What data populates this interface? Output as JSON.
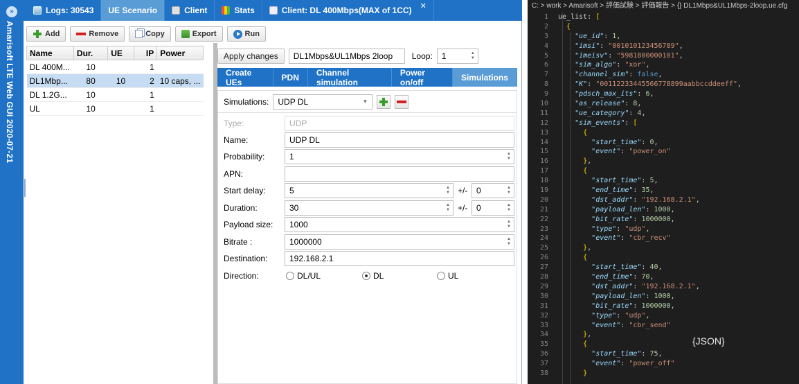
{
  "sidebar": {
    "title": "Amarisoft LTE Web GUI 2020-07-21"
  },
  "tabs": [
    {
      "label": "Logs: 30543"
    },
    {
      "label": "UE Scenario"
    },
    {
      "label": "Client"
    },
    {
      "label": "Stats"
    },
    {
      "label": "Client: DL 400Mbps(MAX of 1CC)"
    }
  ],
  "toolbar": {
    "add": "Add",
    "remove": "Remove",
    "copy": "Copy",
    "export": "Export",
    "run": "Run"
  },
  "ue_table": {
    "headers": [
      "Name",
      "Dur.",
      "UE",
      "IP",
      "Power"
    ],
    "rows": [
      [
        "DL 400M...",
        "10",
        "",
        "1",
        ""
      ],
      [
        "DL1Mbp...",
        "80",
        "10",
        "2",
        "10 caps, ..."
      ],
      [
        "DL 1.2G...",
        "10",
        "",
        "1",
        ""
      ],
      [
        "UL",
        "10",
        "",
        "1",
        ""
      ]
    ]
  },
  "scenario": {
    "apply": "Apply changes",
    "name": "DL1Mbps&UL1Mbps 2loop",
    "loop_label": "Loop:",
    "loop": "1"
  },
  "subtabs": [
    "Create UEs",
    "PDN",
    "Channel simulation",
    "Power on/off",
    "Simulations"
  ],
  "simulations": {
    "label": "Simulations:",
    "selected": "UDP DL"
  },
  "form": {
    "type": {
      "label": "Type:",
      "value": "UDP"
    },
    "name": {
      "label": "Name:",
      "value": "UDP DL"
    },
    "probability": {
      "label": "Probability:",
      "value": "1"
    },
    "apn": {
      "label": "APN:",
      "value": ""
    },
    "start_delay": {
      "label": "Start delay:",
      "value": "5",
      "pm": "+/-",
      "var": "0"
    },
    "duration": {
      "label": "Duration:",
      "value": "30",
      "pm": "+/-",
      "var": "0"
    },
    "payload": {
      "label": "Payload size:",
      "value": "1000"
    },
    "bitrate": {
      "label": "Bitrate :",
      "value": "1000000"
    },
    "destination": {
      "label": "Destination:",
      "value": "192.168.2.1"
    },
    "direction": {
      "label": "Direction:",
      "options": [
        "DL/UL",
        "DL",
        "UL"
      ],
      "selected": "DL"
    }
  },
  "editor": {
    "breadcrumb": "C: > work > Amarisoft > 評価試験 > 評価報告 > {} DL1Mbps&UL1Mbps-2loop.ue.cfg",
    "lines": [
      "ue_list: [",
      "  {",
      "    \"ue_id\": 1,",
      "    \"imsi\": \"001010123456789\",",
      "    \"imeisv\": \"5981800000101\",",
      "    \"sim_algo\": \"xor\",",
      "    \"channel_sim\": false,",
      "    \"K\": \"00112233445566778899aabbccddeeff\",",
      "    \"pdsch_max_its\": 6,",
      "    \"as_release\": 8,",
      "    \"ue_category\": 4,",
      "    \"sim_events\": [",
      "      {",
      "        \"start_time\": 0,",
      "        \"event\": \"power_on\"",
      "      },",
      "      {",
      "        \"start_time\": 5,",
      "        \"end_time\": 35,",
      "        \"dst_addr\": \"192.168.2.1\",",
      "        \"payload_len\": 1000,",
      "        \"bit_rate\": 1000000,",
      "        \"type\": \"udp\",",
      "        \"event\": \"cbr_recv\"",
      "      },",
      "      {",
      "        \"start_time\": 40,",
      "        \"end_time\": 70,",
      "        \"dst_addr\": \"192.168.2.1\",",
      "        \"payload_len\": 1000,",
      "        \"bit_rate\": 1000000,",
      "        \"type\": \"udp\",",
      "        \"event\": \"cbr_send\"",
      "      },",
      "      {",
      "        \"start_time\": 75,",
      "        \"event\": \"power_off\"",
      "      }"
    ],
    "annotation": "{JSON}"
  },
  "colors": {
    "accent": "#1f72c6",
    "tab_active": "#5a9cd6",
    "selection": "#c6dcf2",
    "editor_bg": "#1e1e1e"
  }
}
